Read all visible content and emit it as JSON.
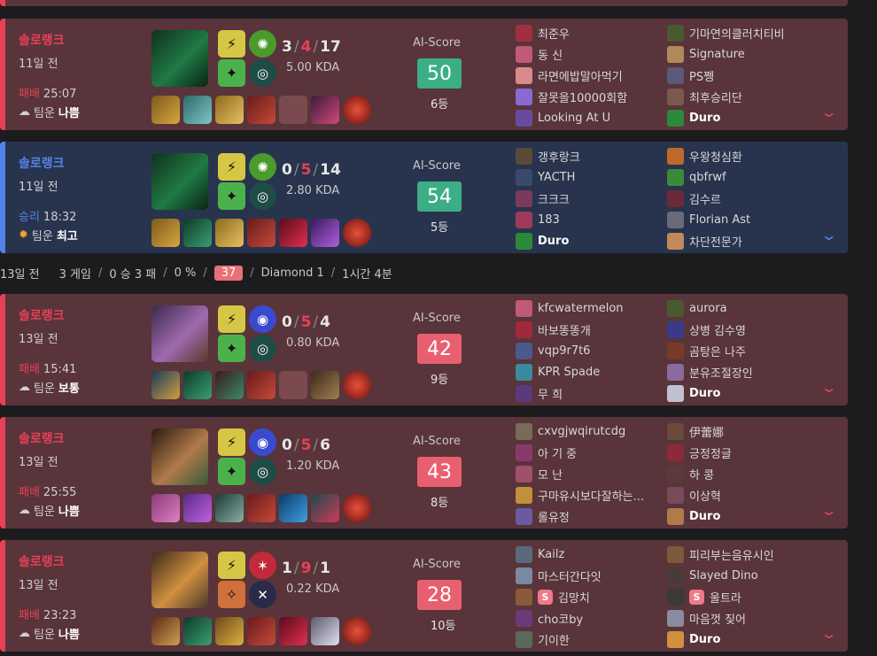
{
  "colors": {
    "loss": "#e84057",
    "win": "#5383e8",
    "loss_bg": "#59343a",
    "win_bg": "#28344e",
    "score_green": "#3cae86",
    "score_red": "#e86070"
  },
  "ai_label": "AI-Score",
  "summary": {
    "date": "13일 전",
    "games": "3 게임",
    "record": "0 승 3 패",
    "winrate": "0 %",
    "score": "37",
    "tier": "Diamond 1",
    "playtime": "1시간 4분"
  },
  "matches": [
    {
      "queue": "솔로랭크",
      "ago": "11일 전",
      "result": "패배",
      "duration": "25:07",
      "weather_icon": "snow-cloud-icon",
      "luck_label": "팀운",
      "luck": "나쁨",
      "kills": "3",
      "deaths": "4",
      "assists": "17",
      "kda": "5.00 KDA",
      "ai_score": "50",
      "rank": "6등",
      "score_color": "green",
      "team1": [
        "최준우",
        "동 신",
        "라면에밥말아먹기",
        "잘못을10000회함",
        "Looking At U"
      ],
      "team2": [
        "기마연의클러치티비",
        "Signature",
        "PS쩽",
        "최후승리단",
        "Duro"
      ],
      "me_team": 2,
      "me_idx": 4
    },
    {
      "queue": "솔로랭크",
      "ago": "11일 전",
      "result": "승리",
      "duration": "18:32",
      "weather_icon": "sun-icon",
      "luck_label": "팀운",
      "luck": "최고",
      "kills": "0",
      "deaths": "5",
      "assists": "14",
      "kda": "2.80 KDA",
      "ai_score": "54",
      "rank": "5등",
      "score_color": "green",
      "team1": [
        "갱후랑크",
        "YACTH",
        "크크크",
        "183",
        "Duro"
      ],
      "team2": [
        "우왕청심환",
        "qbfrwf",
        "김수르",
        "Florian Ast",
        "차단전문가"
      ],
      "me_team": 1,
      "me_idx": 4
    },
    {
      "queue": "솔로랭크",
      "ago": "13일 전",
      "result": "패배",
      "duration": "15:41",
      "weather_icon": "cloud-icon",
      "luck_label": "팀운",
      "luck": "보통",
      "kills": "0",
      "deaths": "5",
      "assists": "4",
      "kda": "0.80 KDA",
      "ai_score": "42",
      "rank": "9등",
      "score_color": "red",
      "team1": [
        "kfcwatermelon",
        "바보똥똥개",
        "vqp9r7t6",
        "KPR Spade",
        "무 희"
      ],
      "team2": [
        "aurora",
        "상병 김수영",
        "곰탕은 나주",
        "분유조절장인",
        "Duro"
      ],
      "me_team": 2,
      "me_idx": 4
    },
    {
      "queue": "솔로랭크",
      "ago": "13일 전",
      "result": "패배",
      "duration": "25:55",
      "weather_icon": "snow-cloud-icon",
      "luck_label": "팀운",
      "luck": "나쁨",
      "kills": "0",
      "deaths": "5",
      "assists": "6",
      "kda": "1.20 KDA",
      "ai_score": "43",
      "rank": "8등",
      "score_color": "red",
      "team1": [
        "cxvgjwqirutcdg",
        "아 기 중",
        "모 난",
        "구마유시보다잘하는...",
        "롤유정"
      ],
      "team2": [
        "伊蕾娜",
        "긍정정글",
        "하 콩",
        "이상혁",
        "Duro"
      ],
      "me_team": 2,
      "me_idx": 4
    },
    {
      "queue": "솔로랭크",
      "ago": "13일 전",
      "result": "패배",
      "duration": "23:23",
      "weather_icon": "snow-cloud-icon",
      "luck_label": "팀운",
      "luck": "나쁨",
      "kills": "1",
      "deaths": "9",
      "assists": "1",
      "kda": "0.22 KDA",
      "ai_score": "28",
      "rank": "10등",
      "score_color": "red",
      "team1": [
        "Kailz",
        "마스터간다잇",
        "김망치",
        "cho코by",
        "기이한"
      ],
      "team2": [
        "피리부는음유시인",
        "Slayed Dino",
        "울트라",
        "마음껏 짖어",
        "Duro"
      ],
      "me_team": 2,
      "me_idx": 4,
      "s_badge": "S"
    }
  ]
}
